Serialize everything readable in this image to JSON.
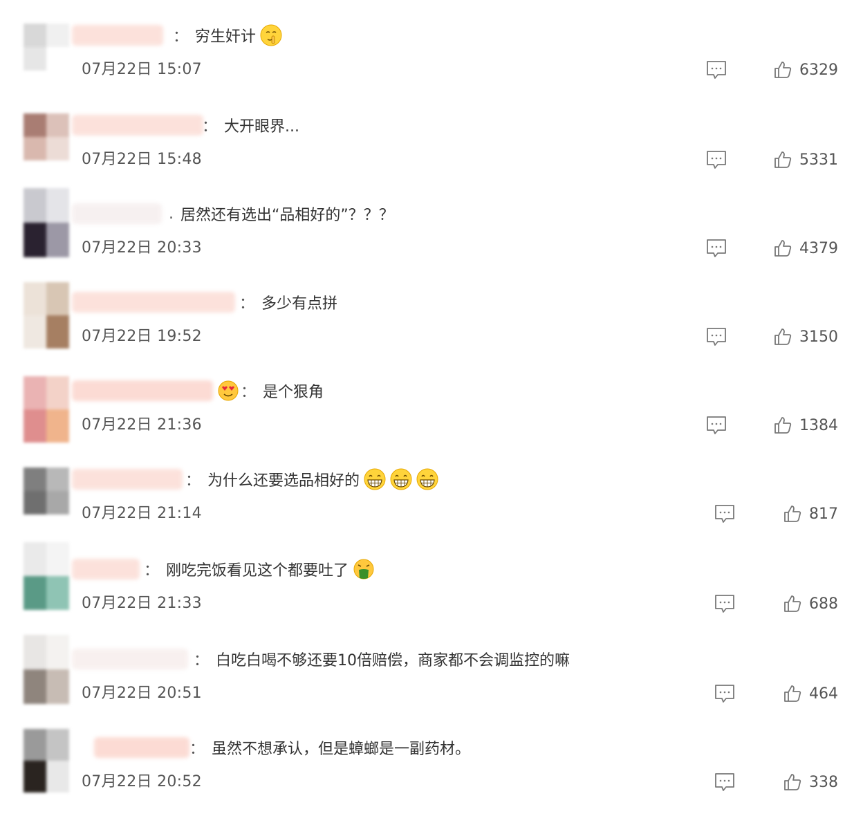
{
  "comments": [
    {
      "separator": "：",
      "text": "穷生奸计",
      "emoji": "shush-face-emoji",
      "time": "07月22日 15:07",
      "likes": "6329"
    },
    {
      "separator": "：",
      "text": "大开眼界...",
      "emoji": "",
      "time": "07月22日 15:48",
      "likes": "5331"
    },
    {
      "separator": ".",
      "text": "居然还有选出“品相好的”？？？",
      "emoji": "",
      "time": "07月22日 20:33",
      "likes": "4379"
    },
    {
      "separator": "：",
      "text": "多少有点拼",
      "emoji": "",
      "time": "07月22日 19:52",
      "likes": "3150"
    },
    {
      "separator": "：",
      "text": "是个狠角",
      "emoji": "heart-eyes-emoji",
      "time": "07月22日 21:36",
      "likes": "1384"
    },
    {
      "separator": "：",
      "text": "为什么还要选品相好的",
      "emoji": "grin-emoji-x3",
      "time": "07月22日 21:14",
      "likes": "817"
    },
    {
      "separator": "：",
      "text": "刚吃完饭看见这个都要吐了",
      "emoji": "vomit-face-emoji",
      "time": "07月22日 21:33",
      "likes": "688"
    },
    {
      "separator": "：",
      "text": "白吃白喝不够还要10倍赔偿，商家都不会调监控的嘛",
      "emoji": "",
      "time": "07月22日 20:51",
      "likes": "464"
    },
    {
      "separator": "：",
      "text": "虽然不想承认，但是蟑螂是一副药材。",
      "emoji": "",
      "time": "07月22日 20:52",
      "likes": "338"
    }
  ]
}
